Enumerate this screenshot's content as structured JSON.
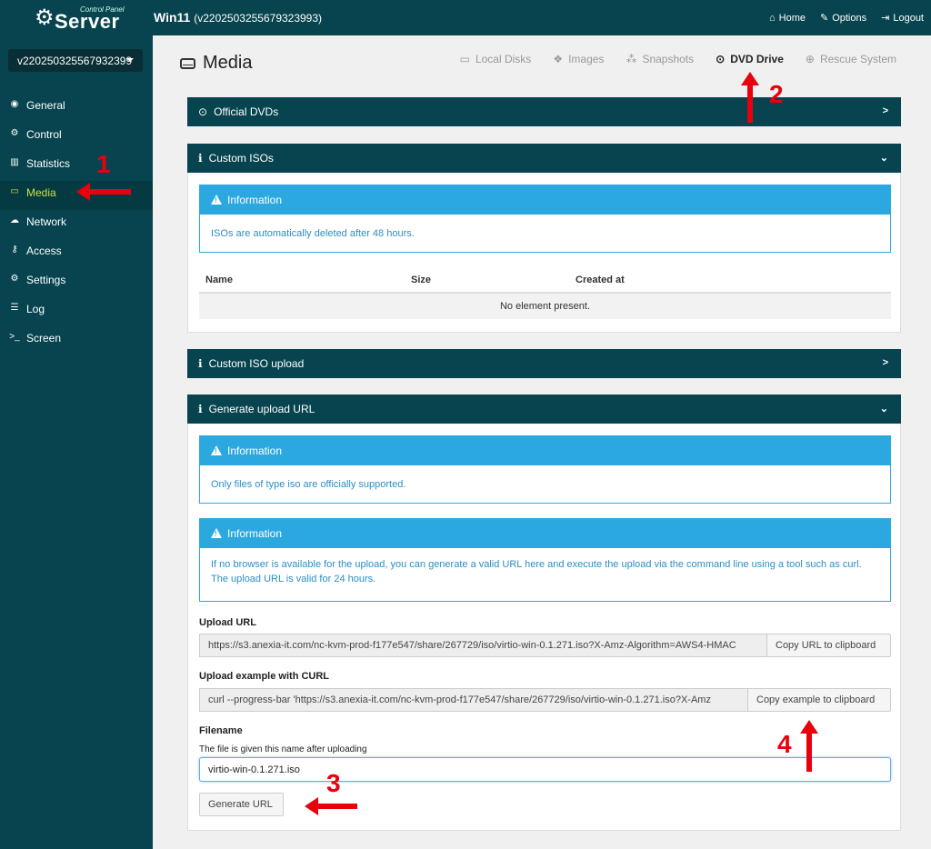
{
  "header": {
    "logo_small": "Control Panel",
    "logo_big": "Server",
    "window_title": "Win11",
    "window_id": "(v2202503255679323993)",
    "nav": [
      {
        "label": "Home",
        "icon": "home-icon"
      },
      {
        "label": "Options",
        "icon": "wrench-icon"
      },
      {
        "label": "Logout",
        "icon": "logout-icon"
      }
    ]
  },
  "sidebar": {
    "server_select": "v220250325567932399",
    "items": [
      {
        "label": "General",
        "icon": "eye-icon"
      },
      {
        "label": "Control",
        "icon": "gear-icon"
      },
      {
        "label": "Statistics",
        "icon": "bar-chart-icon"
      },
      {
        "label": "Media",
        "icon": "hdd-icon",
        "active": true
      },
      {
        "label": "Network",
        "icon": "cloud-icon"
      },
      {
        "label": "Access",
        "icon": "key-icon"
      },
      {
        "label": "Settings",
        "icon": "gears-icon"
      },
      {
        "label": "Log",
        "icon": "list-icon"
      },
      {
        "label": "Screen",
        "icon": "terminal-icon"
      }
    ]
  },
  "main": {
    "title": "Media",
    "tabs": [
      {
        "label": "Local Disks",
        "icon": "hdd-icon"
      },
      {
        "label": "Images",
        "icon": "cubes-icon"
      },
      {
        "label": "Snapshots",
        "icon": "sitemap-icon"
      },
      {
        "label": "DVD Drive",
        "icon": "dvd-icon",
        "active": true
      },
      {
        "label": "Rescue System",
        "icon": "lifebuoy-icon"
      }
    ],
    "panels": {
      "official_dvds": "Official DVDs",
      "custom_isos": "Custom ISOs",
      "custom_iso_upload": "Custom ISO upload",
      "generate_upload_url": "Generate upload URL"
    },
    "info_title": "Information",
    "info_isos": "ISOs are automatically deleted after 48 hours.",
    "info_iso_only": "Only files of type iso are officially supported.",
    "info_no_browser": "If no browser is available for the upload, you can generate a valid URL here and execute the upload via the command line using a tool such as curl. The upload URL is valid for 24 hours.",
    "table": {
      "columns": [
        "Name",
        "Size",
        "Created at"
      ],
      "empty": "No element present."
    },
    "upload_url_label": "Upload URL",
    "upload_url_value": "https://s3.anexia-it.com/nc-kvm-prod-f177e547/share/267729/iso/virtio-win-0.1.271.iso?X-Amz-Algorithm=AWS4-HMAC",
    "copy_url_button": "Copy URL to clipboard",
    "curl_label": "Upload example with CURL",
    "curl_value": "curl --progress-bar 'https://s3.anexia-it.com/nc-kvm-prod-f177e547/share/267729/iso/virtio-win-0.1.271.iso?X-Amz",
    "copy_example_button": "Copy example to clipboard",
    "filename_label": "Filename",
    "filename_help": "The file is given this name after uploading",
    "filename_value": "virtio-win-0.1.271.iso",
    "generate_button": "Generate URL"
  },
  "annotations": [
    "1",
    "2",
    "3",
    "4"
  ],
  "colors": {
    "sidebar_bg": "#07444f",
    "accent_active": "#c6e23a",
    "info_blue": "#2ca8e0",
    "annotation_red": "#e8000c"
  }
}
